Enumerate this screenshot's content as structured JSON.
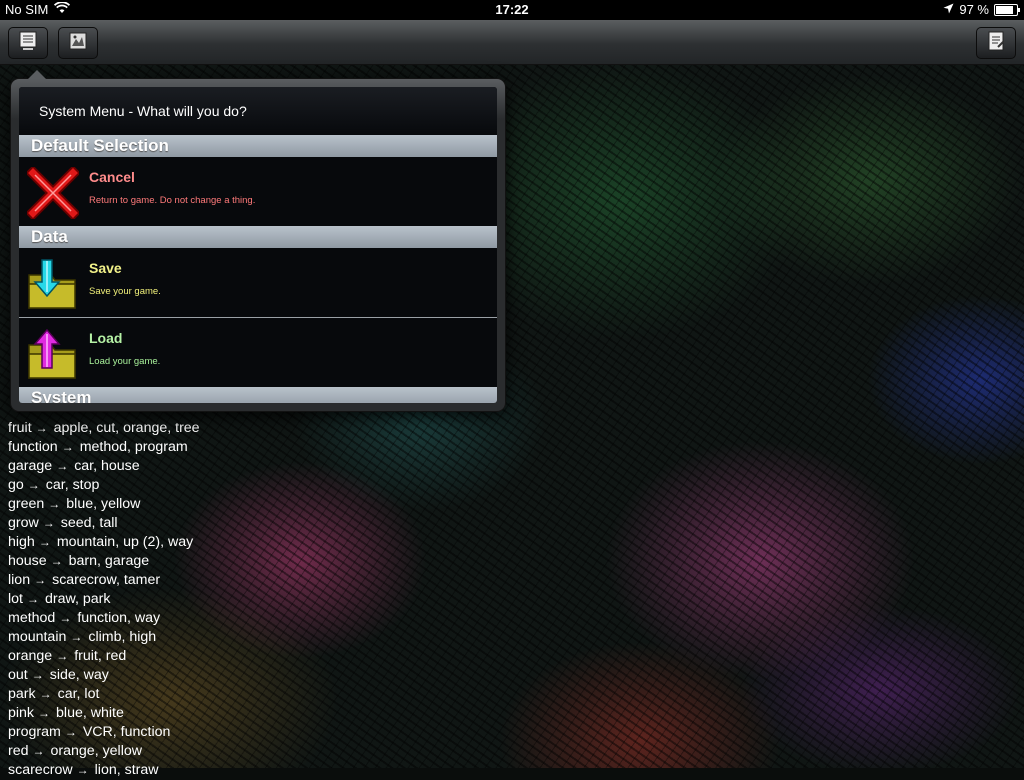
{
  "status_bar": {
    "carrier": "No SIM",
    "time": "17:22",
    "battery": "97 %",
    "battery_level": 0.97
  },
  "toolbar": {
    "left_buttons": [
      "menu-icon",
      "map-icon"
    ],
    "right_button": "notes-icon"
  },
  "word_list": [
    {
      "word": "fruit",
      "links": "apple, cut, orange, tree"
    },
    {
      "word": "function",
      "links": "method, program"
    },
    {
      "word": "garage",
      "links": "car, house"
    },
    {
      "word": "go",
      "links": "car, stop"
    },
    {
      "word": "green",
      "links": "blue, yellow"
    },
    {
      "word": "grow",
      "links": "seed, tall"
    },
    {
      "word": "high",
      "links": "mountain, up (2), way"
    },
    {
      "word": "house",
      "links": "barn, garage"
    },
    {
      "word": "lion",
      "links": "scarecrow, tamer"
    },
    {
      "word": "lot",
      "links": "draw, park"
    },
    {
      "word": "method",
      "links": "function, way"
    },
    {
      "word": "mountain",
      "links": "climb, high"
    },
    {
      "word": "orange",
      "links": "fruit, red"
    },
    {
      "word": "out",
      "links": "side, way"
    },
    {
      "word": "park",
      "links": "car, lot"
    },
    {
      "word": "pink",
      "links": "blue, white"
    },
    {
      "word": "program",
      "links": "VCR, function"
    },
    {
      "word": "red",
      "links": "orange, yellow"
    },
    {
      "word": "scarecrow",
      "links": "lion, straw"
    }
  ],
  "menu": {
    "title": "System Menu - What will you do?",
    "sections": {
      "default": {
        "header": "Default Selection",
        "cancel": {
          "label": "Cancel",
          "desc": "Return to game.  Do not change a thing.",
          "color": "#ff8c8c"
        }
      },
      "data": {
        "header": "Data",
        "save": {
          "label": "Save",
          "desc": "Save your game.",
          "color": "#f2f28a"
        },
        "load": {
          "label": "Load",
          "desc": "Load your game.",
          "color": "#b6f2a6"
        }
      },
      "system": {
        "header": "System"
      }
    }
  },
  "colors": {
    "cancel_desc": "#ff7a7a",
    "save_desc": "#f0f07a",
    "load_desc": "#a8f09a"
  }
}
